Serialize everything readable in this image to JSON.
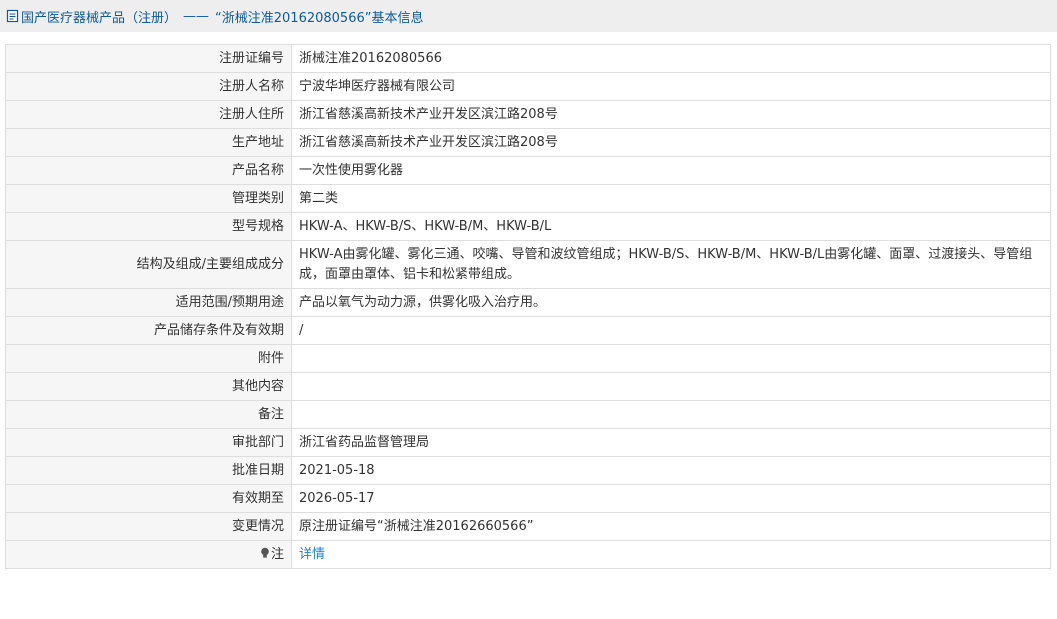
{
  "header": {
    "title": "国产医疗器械产品（注册）",
    "separator": "——",
    "subtitle": "“浙械注准20162080566”基本信息"
  },
  "rows": [
    {
      "label": "注册证编号",
      "value": "浙械注准20162080566"
    },
    {
      "label": "注册人名称",
      "value": "宁波华坤医疗器械有限公司"
    },
    {
      "label": "注册人住所",
      "value": "浙江省慈溪高新技术产业开发区滨江路208号"
    },
    {
      "label": "生产地址",
      "value": "浙江省慈溪高新技术产业开发区滨江路208号"
    },
    {
      "label": "产品名称",
      "value": "一次性使用雾化器"
    },
    {
      "label": "管理类别",
      "value": "第二类"
    },
    {
      "label": "型号规格",
      "value": "HKW-A、HKW-B/S、HKW-B/M、HKW-B/L"
    },
    {
      "label": "结构及组成/主要组成成分",
      "value": "HKW-A由雾化罐、雾化三通、咬嘴、导管和波纹管组成；HKW-B/S、HKW-B/M、HKW-B/L由雾化罐、面罩、过渡接头、导管组成，面罩由罩体、铝卡和松紧带组成。"
    },
    {
      "label": "适用范围/预期用途",
      "value": "产品以氧气为动力源，供雾化吸入治疗用。"
    },
    {
      "label": "产品储存条件及有效期",
      "value": "/"
    },
    {
      "label": "附件",
      "value": ""
    },
    {
      "label": "其他内容",
      "value": ""
    },
    {
      "label": "备注",
      "value": ""
    },
    {
      "label": "审批部门",
      "value": "浙江省药品监督管理局"
    },
    {
      "label": "批准日期",
      "value": "2021-05-18"
    },
    {
      "label": "有效期至",
      "value": "2026-05-17"
    },
    {
      "label": "变更情况",
      "value": "原注册证编号“浙械注准20162660566”"
    }
  ],
  "note_row": {
    "label": "注",
    "link_text": "详情"
  },
  "colors": {
    "title": "#0d5b9e",
    "link": "#1e7ed6",
    "label_bg": "#f6f6f6",
    "border": "#dddddd"
  }
}
